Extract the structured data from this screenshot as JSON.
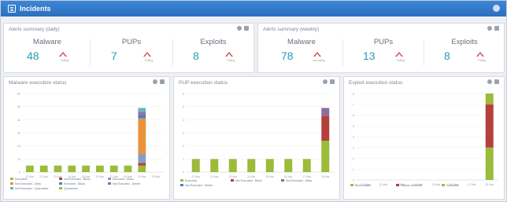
{
  "header": {
    "title": "Incidents"
  },
  "summaries": [
    {
      "title": "Alerts summary (daily)",
      "metrics": [
        {
          "label": "Malware",
          "value": "48",
          "trend": "Falling"
        },
        {
          "label": "PUPs",
          "value": "7",
          "trend": "Falling"
        },
        {
          "label": "Exploits",
          "value": "8",
          "trend": "Falling"
        }
      ]
    },
    {
      "title": "Alerts summary (weekly)",
      "metrics": [
        {
          "label": "Malware",
          "value": "78",
          "trend": "Increasing"
        },
        {
          "label": "PUPs",
          "value": "13",
          "trend": "Falling"
        },
        {
          "label": "Exploits",
          "value": "8",
          "trend": "Falling"
        }
      ]
    }
  ],
  "chart_titles": [
    "Malware execution status",
    "PUP execution status",
    "Exploit execution status"
  ],
  "chart_data": [
    {
      "type": "bar",
      "title": "Malware execution status",
      "categories": [
        "21 Mar",
        "22 Mar",
        "23 Mar",
        "24 Mar",
        "25 Mar",
        "26 Mar",
        "27 Mar",
        "28 Mar",
        "29 Mar",
        "30 Mar"
      ],
      "ylim": [
        0,
        60
      ],
      "yticks": [
        0,
        10,
        20,
        30,
        40,
        50,
        60
      ],
      "series": [
        {
          "name": "Executed",
          "color": "#9bbb3a",
          "values": [
            5,
            5,
            5,
            5,
            5,
            5,
            5,
            5,
            5,
            0
          ]
        },
        {
          "name": "Not Executed - Block",
          "color": "#b6403a",
          "values": [
            0,
            0,
            0,
            0,
            0,
            0,
            0,
            0,
            2,
            0
          ]
        },
        {
          "name": "Executed - Allow",
          "color": "#8a9cc2",
          "values": [
            0,
            0,
            0,
            0,
            0,
            0,
            0,
            0,
            7,
            0
          ]
        },
        {
          "name": "Not Executed - Allow",
          "color": "#e9923a",
          "values": [
            0,
            0,
            0,
            0,
            0,
            0,
            0,
            0,
            27,
            0
          ]
        },
        {
          "name": "Executed - Block",
          "color": "#4f7fc0",
          "values": [
            0,
            0,
            0,
            0,
            0,
            0,
            0,
            0,
            3,
            0
          ]
        },
        {
          "name": "Not Executed - Delete",
          "color": "#8b6f9e",
          "values": [
            0,
            0,
            0,
            0,
            0,
            0,
            0,
            0,
            2,
            0
          ]
        },
        {
          "name": "Not Executed - Quarantine",
          "color": "#6fb0c6",
          "values": [
            0,
            0,
            0,
            0,
            0,
            0,
            0,
            0,
            3,
            0
          ]
        },
        {
          "name": "Quarantine",
          "color": "#9bbb3a",
          "values": [
            0,
            0,
            0,
            0,
            0,
            0,
            0,
            0,
            0,
            0
          ]
        }
      ]
    },
    {
      "type": "bar",
      "title": "PUP execution status",
      "categories": [
        "21 Mar",
        "22 Mar",
        "23 Mar",
        "24 Mar",
        "25 Mar",
        "26 Mar",
        "27 Mar",
        "28 Mar"
      ],
      "ylim": [
        0,
        6
      ],
      "yticks": [
        0,
        1,
        2,
        3,
        4,
        5,
        6
      ],
      "series": [
        {
          "name": "Executed",
          "color": "#9bbb3a",
          "values": [
            1,
            1,
            1,
            1,
            1,
            1,
            1,
            2.4
          ]
        },
        {
          "name": "Not Executed - Block",
          "color": "#b6403a",
          "values": [
            0,
            0,
            0,
            0,
            0,
            0,
            0,
            1.9
          ]
        },
        {
          "name": "Not Executed - Allow",
          "color": "#8b6f9e",
          "values": [
            0,
            0,
            0,
            0,
            0,
            0,
            0,
            0.6
          ]
        },
        {
          "name": "Not Executed - Delete",
          "color": "#4f7fc0",
          "values": [
            0,
            0,
            0,
            0,
            0,
            0,
            0,
            0
          ]
        }
      ]
    },
    {
      "type": "bar",
      "title": "Exploit execution status",
      "categories": [
        "21 Mar",
        "22 Mar",
        "23 Mar",
        "24 Mar",
        "25 Mar",
        "26 Mar",
        "27 Mar",
        "28 Mar"
      ],
      "ylim": [
        0,
        8
      ],
      "yticks": [
        0,
        1,
        2,
        3,
        4,
        5,
        6,
        7,
        8
      ],
      "series": [
        {
          "name": "Block exploit",
          "color": "#9bbb3a",
          "values": [
            0,
            0,
            0,
            0,
            0,
            0,
            0,
            3
          ]
        },
        {
          "name": "Explore detected",
          "color": "#b6403a",
          "values": [
            0,
            0,
            0,
            0,
            0,
            0,
            0,
            4
          ]
        },
        {
          "name": "Sefinance",
          "color": "#9bbb3a",
          "values": [
            0,
            0,
            0,
            0,
            0,
            0,
            0,
            1
          ]
        }
      ]
    }
  ]
}
